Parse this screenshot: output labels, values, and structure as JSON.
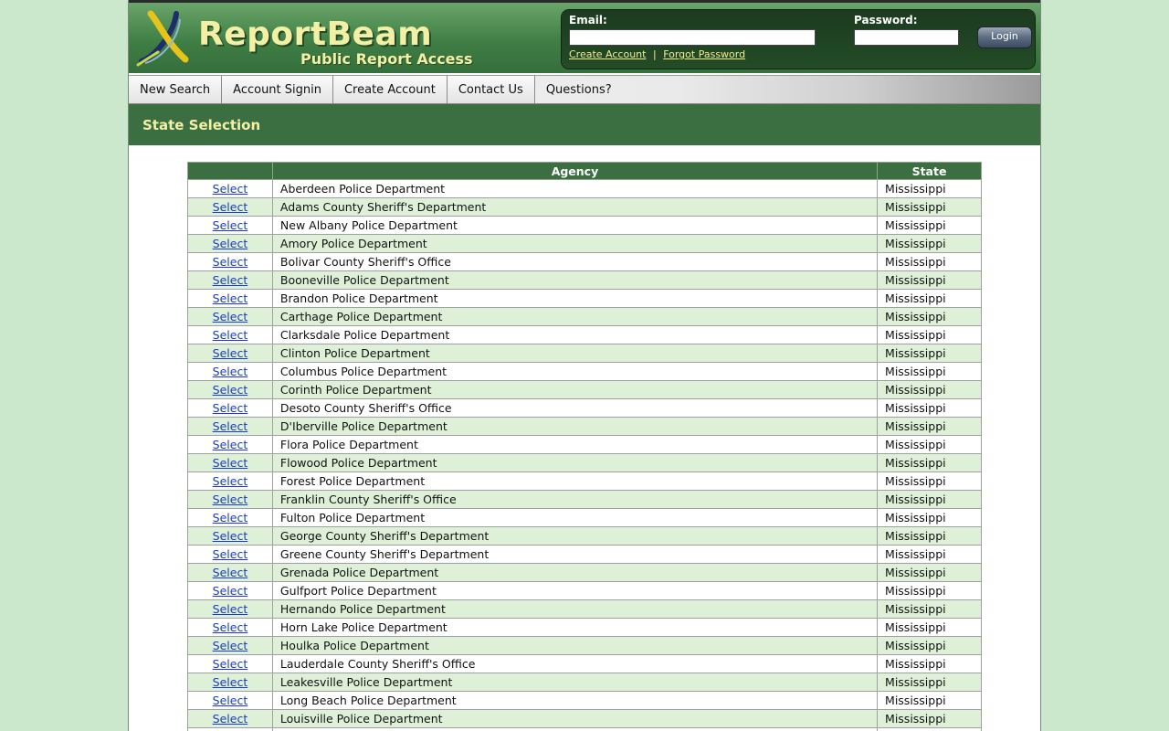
{
  "header": {
    "brand": "ReportBeam",
    "tagline": "Public Report Access",
    "email_label": "Email:",
    "password_label": "Password:",
    "email_value": "",
    "password_value": "",
    "create_account_link": "Create Account",
    "separator": "|",
    "forgot_password_link": "Forgot Password",
    "login_button": "Login"
  },
  "nav": {
    "items": [
      "New Search",
      "Account Signin",
      "Create Account",
      "Contact Us",
      "Questions?"
    ]
  },
  "section": {
    "title": "State Selection"
  },
  "table": {
    "headers": [
      "",
      "Agency",
      "State"
    ],
    "select_label": "Select",
    "rows": [
      {
        "agency": "Aberdeen Police Department",
        "state": "Mississippi"
      },
      {
        "agency": "Adams County Sheriff's Department",
        "state": "Mississippi"
      },
      {
        "agency": "New Albany Police Department",
        "state": "Mississippi"
      },
      {
        "agency": "Amory Police Department",
        "state": "Mississippi"
      },
      {
        "agency": "Bolivar County Sheriff's Office",
        "state": "Mississippi"
      },
      {
        "agency": "Booneville Police Department",
        "state": "Mississippi"
      },
      {
        "agency": "Brandon Police Department",
        "state": "Mississippi"
      },
      {
        "agency": "Carthage Police Department",
        "state": "Mississippi"
      },
      {
        "agency": "Clarksdale Police Department",
        "state": "Mississippi"
      },
      {
        "agency": "Clinton Police Department",
        "state": "Mississippi"
      },
      {
        "agency": "Columbus Police Department",
        "state": "Mississippi"
      },
      {
        "agency": "Corinth Police Department",
        "state": "Mississippi"
      },
      {
        "agency": "Desoto County Sheriff's Office",
        "state": "Mississippi"
      },
      {
        "agency": "D'Iberville Police Department",
        "state": "Mississippi"
      },
      {
        "agency": "Flora Police Department",
        "state": "Mississippi"
      },
      {
        "agency": "Flowood Police Department",
        "state": "Mississippi"
      },
      {
        "agency": "Forest Police Department",
        "state": "Mississippi"
      },
      {
        "agency": "Franklin County Sheriff's Office",
        "state": "Mississippi"
      },
      {
        "agency": "Fulton Police Department",
        "state": "Mississippi"
      },
      {
        "agency": "George County Sheriff's Department",
        "state": "Mississippi"
      },
      {
        "agency": "Greene County Sheriff's Department",
        "state": "Mississippi"
      },
      {
        "agency": "Grenada Police Department",
        "state": "Mississippi"
      },
      {
        "agency": "Gulfport Police Department",
        "state": "Mississippi"
      },
      {
        "agency": "Hernando Police Department",
        "state": "Mississippi"
      },
      {
        "agency": "Horn Lake Police Department",
        "state": "Mississippi"
      },
      {
        "agency": "Houlka Police Department",
        "state": "Mississippi"
      },
      {
        "agency": "Lauderdale County Sheriff's Office",
        "state": "Mississippi"
      },
      {
        "agency": "Leakesville Police Department",
        "state": "Mississippi"
      },
      {
        "agency": "Long Beach Police Department",
        "state": "Mississippi"
      },
      {
        "agency": "Louisville Police Department",
        "state": "Mississippi"
      },
      {
        "agency": "",
        "state": ""
      }
    ]
  },
  "colors": {
    "page_bg": "#cce8cc",
    "header_green": "#3f7e45",
    "accent_yellow": "#f3f0a6",
    "row_alt": "#dff0d8",
    "link_blue": "#1a3dbf"
  },
  "icons": {
    "logo": "reportbeam-swoosh-logo"
  }
}
